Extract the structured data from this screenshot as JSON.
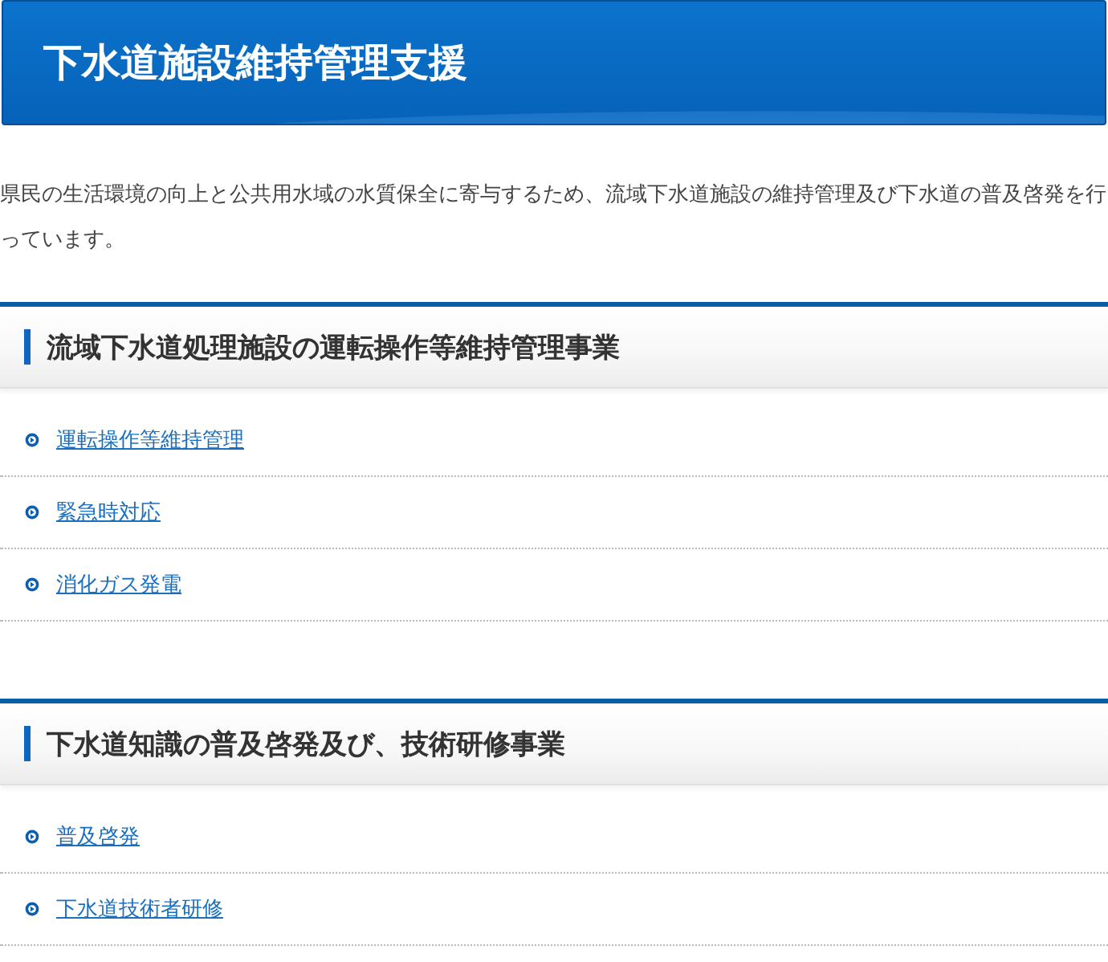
{
  "page_title": "下水道施設維持管理支援",
  "intro": "県民の生活環境の向上と公共用水域の水質保全に寄与するため、流域下水道施設の維持管理及び下水道の普及啓発を行っています。",
  "sections": [
    {
      "heading": "流域下水道処理施設の運転操作等維持管理事業",
      "links": [
        "運転操作等維持管理",
        "緊急時対応",
        "消化ガス発電"
      ]
    },
    {
      "heading": "下水道知識の普及啓発及び、技術研修事業",
      "links": [
        "普及啓発",
        "下水道技術者研修"
      ]
    }
  ]
}
